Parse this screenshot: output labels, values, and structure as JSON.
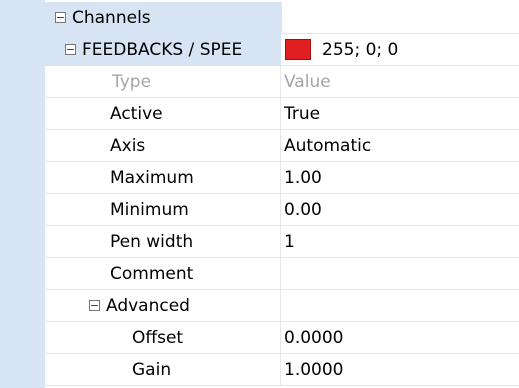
{
  "colors": {
    "gutter": "#d7e4f4",
    "swatch": "#e02020",
    "header_text": "#a6a6a6"
  },
  "tree": {
    "root_label": "Channels",
    "channel_label": "FEEDBACKS / SPEE",
    "channel_value": "255; 0; 0",
    "advanced_label": "Advanced",
    "expander_glyph": "−"
  },
  "header": {
    "name": "Type",
    "value": "Value"
  },
  "properties": [
    {
      "name": "Active",
      "value": "True"
    },
    {
      "name": "Axis",
      "value": "Automatic"
    },
    {
      "name": "Maximum",
      "value": "1.00"
    },
    {
      "name": "Minimum",
      "value": "0.00"
    },
    {
      "name": "Pen width",
      "value": "1"
    },
    {
      "name": "Comment",
      "value": ""
    }
  ],
  "advanced": [
    {
      "name": "Offset",
      "value": "0.0000"
    },
    {
      "name": "Gain",
      "value": "1.0000"
    }
  ]
}
